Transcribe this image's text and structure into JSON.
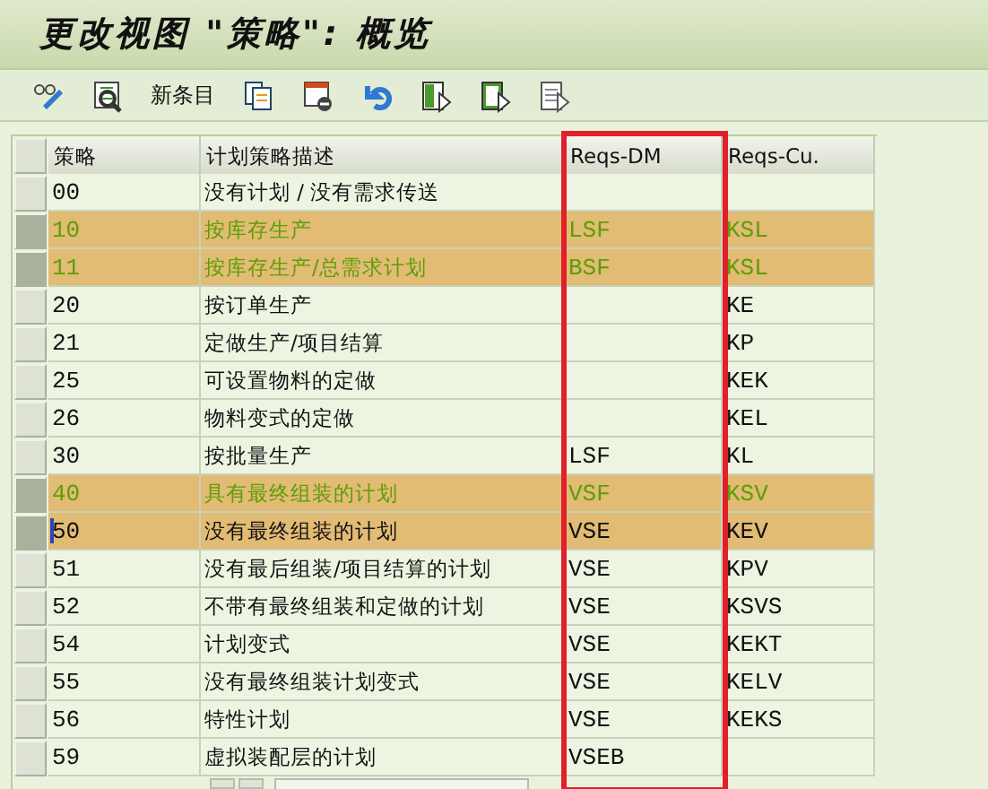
{
  "window": {
    "title": "更改视图 \"策略\": 概览"
  },
  "toolbar": {
    "new_entries_label": "新条目"
  },
  "table": {
    "columns": [
      {
        "label": "策略",
        "outlined": false
      },
      {
        "label": "计划策略描述",
        "outlined": false
      },
      {
        "label": "Reqs-DM",
        "outlined": true
      },
      {
        "label": "Reqs-Cu.",
        "outlined": false
      }
    ],
    "rows": [
      {
        "cells": [
          "00",
          "没有计划 / 没有需求传送",
          "",
          ""
        ],
        "selected": false,
        "highlighted": false,
        "focused": false
      },
      {
        "cells": [
          "10",
          "按库存生产",
          "LSF",
          "KSL"
        ],
        "selected": true,
        "highlighted": true,
        "focused": false
      },
      {
        "cells": [
          "11",
          "按库存生产/总需求计划",
          "BSF",
          "KSL"
        ],
        "selected": true,
        "highlighted": true,
        "focused": false
      },
      {
        "cells": [
          "20",
          "按订单生产",
          "",
          "KE"
        ],
        "selected": false,
        "highlighted": false,
        "focused": false
      },
      {
        "cells": [
          "21",
          "定做生产/项目结算",
          "",
          "KP"
        ],
        "selected": false,
        "highlighted": false,
        "focused": false
      },
      {
        "cells": [
          "25",
          "可设置物料的定做",
          "",
          "KEK"
        ],
        "selected": false,
        "highlighted": false,
        "focused": false
      },
      {
        "cells": [
          "26",
          "物料变式的定做",
          "",
          "KEL"
        ],
        "selected": false,
        "highlighted": false,
        "focused": false
      },
      {
        "cells": [
          "30",
          "按批量生产",
          "LSF",
          "KL"
        ],
        "selected": false,
        "highlighted": false,
        "focused": false
      },
      {
        "cells": [
          "40",
          "具有最终组装的计划",
          "VSF",
          "KSV"
        ],
        "selected": true,
        "highlighted": true,
        "focused": false
      },
      {
        "cells": [
          "50",
          "没有最终组装的计划",
          "VSE",
          "KEV"
        ],
        "selected": true,
        "highlighted": false,
        "focused": true
      },
      {
        "cells": [
          "51",
          "没有最后组装/项目结算的计划",
          "VSE",
          "KPV"
        ],
        "selected": false,
        "highlighted": false,
        "focused": false
      },
      {
        "cells": [
          "52",
          "不带有最终组装和定做的计划",
          "VSE",
          "KSVS"
        ],
        "selected": false,
        "highlighted": false,
        "focused": false
      },
      {
        "cells": [
          "54",
          "计划变式",
          "VSE",
          "KEKT"
        ],
        "selected": false,
        "highlighted": false,
        "focused": false
      },
      {
        "cells": [
          "55",
          "没有最终组装计划变式",
          "VSE",
          "KELV"
        ],
        "selected": false,
        "highlighted": false,
        "focused": false
      },
      {
        "cells": [
          "56",
          "特性计划",
          "VSE",
          "KEKS"
        ],
        "selected": false,
        "highlighted": false,
        "focused": false
      },
      {
        "cells": [
          "59",
          "虚拟装配层的计划",
          "VSEB",
          ""
        ],
        "selected": false,
        "highlighted": false,
        "focused": false
      }
    ]
  }
}
